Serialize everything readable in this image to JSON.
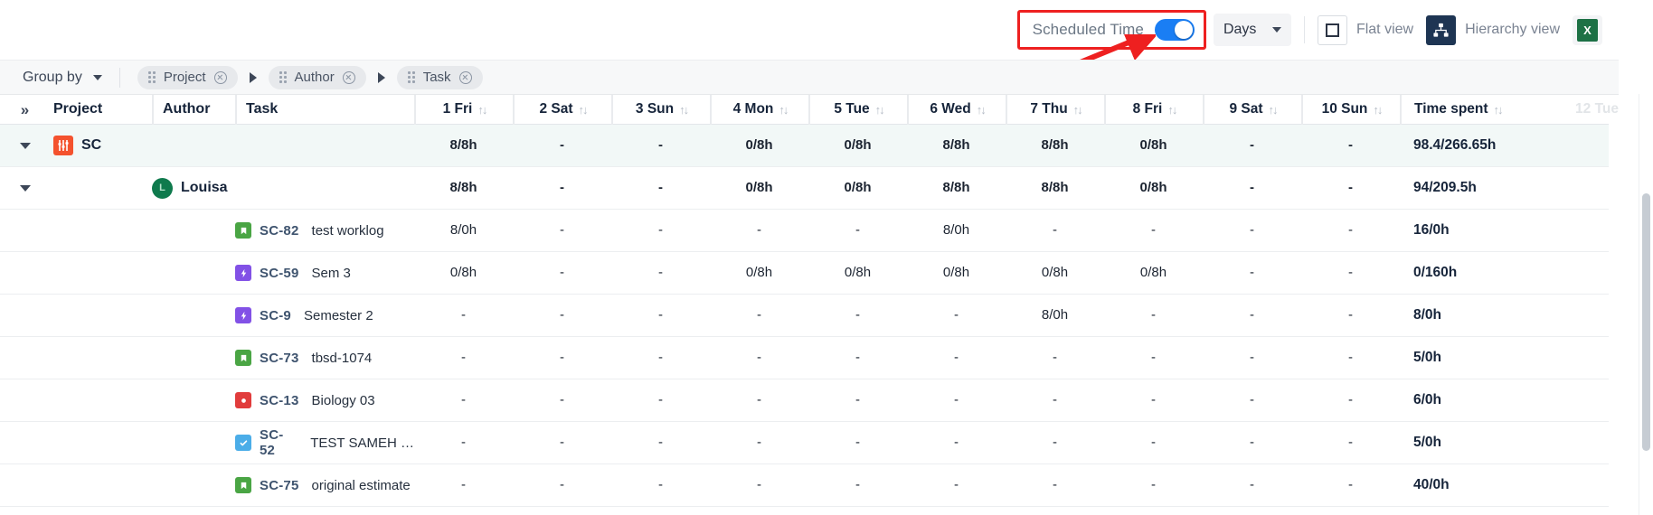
{
  "toolbar": {
    "scheduled_time_label": "Scheduled Time",
    "scheduled_time_on": true,
    "period_select_value": "Days",
    "flat_view_label": "Flat view",
    "hierarchy_view_label": "Hierarchy view",
    "export_label": "X",
    "highlight_color": "#ee2020",
    "toggle_on_color": "#1a7ef4",
    "hierarchy_active_color": "#1e3553",
    "excel_color": "#1d7145"
  },
  "groupbar": {
    "group_by_label": "Group by",
    "chips": [
      {
        "label": "Project"
      },
      {
        "label": "Author"
      },
      {
        "label": "Task"
      }
    ]
  },
  "table": {
    "columns": {
      "expand": "»",
      "project": "Project",
      "author": "Author",
      "task": "Task",
      "total": "Time spent",
      "ghost": "12 Tue"
    },
    "days": [
      "1 Fri",
      "2 Sat",
      "3 Sun",
      "4 Mon",
      "5 Tue",
      "6 Wed",
      "7 Thu",
      "8 Fri",
      "9 Sat",
      "10 Sun"
    ],
    "rows": [
      {
        "type": "project",
        "project": "SC",
        "values": [
          "8/8h",
          "-",
          "-",
          "0/8h",
          "0/8h",
          "8/8h",
          "8/8h",
          "0/8h",
          "-",
          "-"
        ],
        "total": "98.4/266.65h"
      },
      {
        "type": "author",
        "author": "Louisa",
        "avatar_initial": "L",
        "values": [
          "8/8h",
          "-",
          "-",
          "0/8h",
          "0/8h",
          "8/8h",
          "8/8h",
          "0/8h",
          "-",
          "-"
        ],
        "total": "94/209.5h"
      },
      {
        "type": "task",
        "key": "SC-82",
        "summary": "test worklog",
        "icon": "story-icon",
        "icon_color": "#4aa544",
        "values": [
          "8/0h",
          "-",
          "-",
          "-",
          "-",
          "8/0h",
          "-",
          "-",
          "-",
          "-"
        ],
        "total": "16/0h"
      },
      {
        "type": "task",
        "key": "SC-59",
        "summary": "Sem 3",
        "icon": "epic-icon",
        "icon_color": "#8251e6",
        "values": [
          "0/8h",
          "-",
          "-",
          "0/8h",
          "0/8h",
          "0/8h",
          "0/8h",
          "0/8h",
          "-",
          "-"
        ],
        "total": "0/160h"
      },
      {
        "type": "task",
        "key": "SC-9",
        "summary": "Semester 2",
        "icon": "epic-icon",
        "icon_color": "#8251e6",
        "values": [
          "-",
          "-",
          "-",
          "-",
          "-",
          "-",
          "8/0h",
          "-",
          "-",
          "-"
        ],
        "total": "8/0h"
      },
      {
        "type": "task",
        "key": "SC-73",
        "summary": "tbsd-1074",
        "icon": "story-icon",
        "icon_color": "#4aa544",
        "values": [
          "-",
          "-",
          "-",
          "-",
          "-",
          "-",
          "-",
          "-",
          "-",
          "-"
        ],
        "total": "5/0h"
      },
      {
        "type": "task",
        "key": "SC-13",
        "summary": "Biology 03",
        "icon": "bug-icon",
        "icon_color": "#e13c3c",
        "values": [
          "-",
          "-",
          "-",
          "-",
          "-",
          "-",
          "-",
          "-",
          "-",
          "-"
        ],
        "total": "6/0h"
      },
      {
        "type": "task",
        "key": "SC-52",
        "summary": "TEST SAMEH …",
        "icon": "task-icon",
        "icon_color": "#4bade8",
        "values": [
          "-",
          "-",
          "-",
          "-",
          "-",
          "-",
          "-",
          "-",
          "-",
          "-"
        ],
        "total": "5/0h"
      },
      {
        "type": "task",
        "key": "SC-75",
        "summary": "original estimate",
        "icon": "story-icon",
        "icon_color": "#4aa544",
        "values": [
          "-",
          "-",
          "-",
          "-",
          "-",
          "-",
          "-",
          "-",
          "-",
          "-"
        ],
        "total": "40/0h"
      }
    ]
  }
}
